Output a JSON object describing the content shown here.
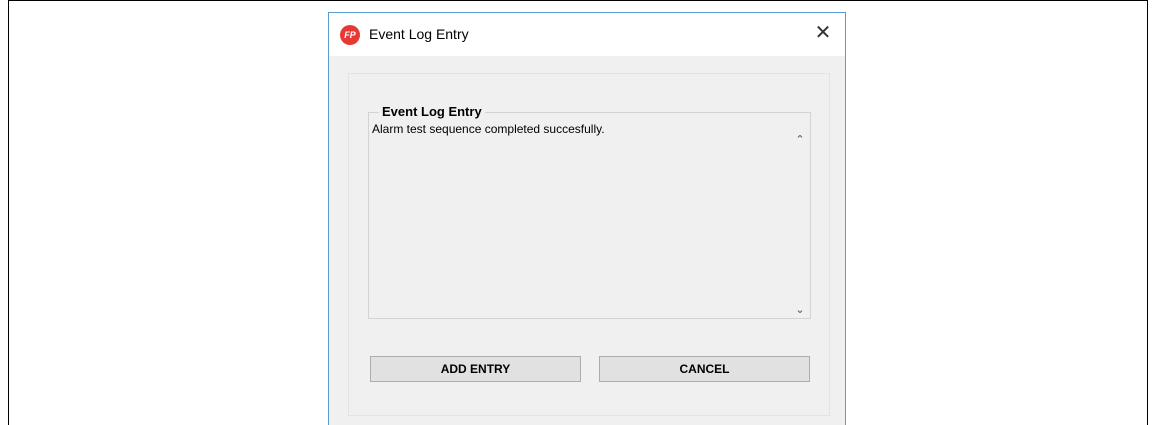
{
  "window": {
    "title": "Event Log Entry",
    "icon_text": "FP",
    "close_symbol": "✕"
  },
  "group": {
    "legend": "Event Log Entry",
    "text": "Alarm test sequence completed succesfully."
  },
  "scrollbar": {
    "up_symbol": "⌃",
    "down_symbol": "⌄"
  },
  "buttons": {
    "add_label": "ADD ENTRY",
    "cancel_label": "CANCEL"
  },
  "colors": {
    "app_icon": "#e53935",
    "window_border": "#5b9bd5"
  }
}
